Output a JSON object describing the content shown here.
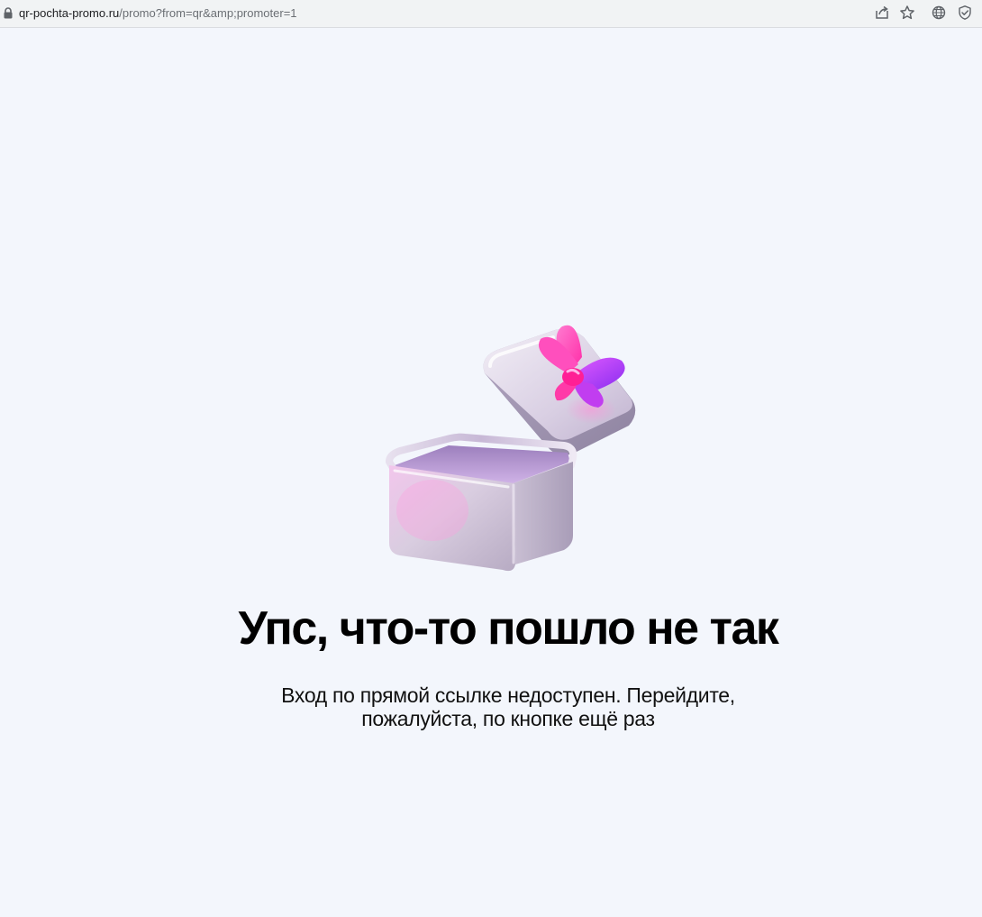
{
  "browser": {
    "url_host": "qr-pochta-promo.ru",
    "url_path": "/promo?from=qr&amp;promoter=1",
    "icons": {
      "lock": "lock-icon",
      "share": "share-icon",
      "bookmark": "star-icon",
      "translate": "globe-icon",
      "shield": "shield-check-icon"
    }
  },
  "page": {
    "illustration": "open-gift-box",
    "title": "Упс, что-то пошло не так",
    "message_line1": "Вход по прямой ссылке недоступен. Перейдите,",
    "message_line2": "пожалуйста, по кнопке ещё раз"
  },
  "colors": {
    "background": "#f3f6fc",
    "text": "#000000",
    "bow_pink": "#ff3fb4",
    "bow_purple": "#a23cf2"
  }
}
